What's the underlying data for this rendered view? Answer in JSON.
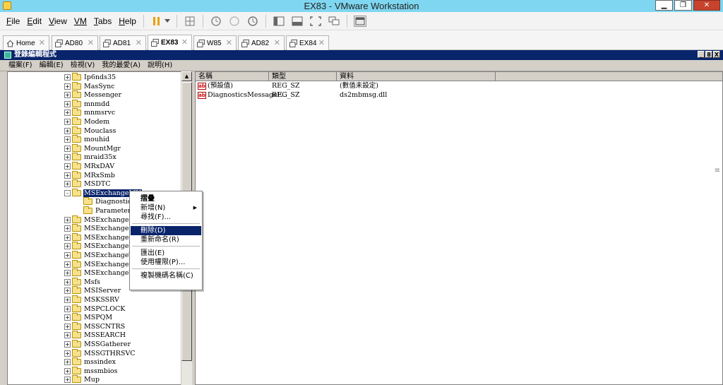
{
  "window": {
    "title": "EX83 - VMware Workstation",
    "controls": {
      "minimize": "▁",
      "restore": "❐",
      "close": "✕"
    }
  },
  "vmware_menu": {
    "items": [
      {
        "mnemonic": "F",
        "rest": "ile"
      },
      {
        "mnemonic": "E",
        "rest": "dit"
      },
      {
        "mnemonic": "V",
        "rest": "iew"
      },
      {
        "mnemonic": "",
        "rest": "VM"
      },
      {
        "mnemonic": "T",
        "rest": "abs"
      },
      {
        "mnemonic": "H",
        "rest": "elp"
      }
    ]
  },
  "tabs": [
    {
      "label": "Home",
      "icon": "home-icon",
      "active": false
    },
    {
      "label": "AD80",
      "icon": "vm-icon",
      "active": false
    },
    {
      "label": "AD81",
      "icon": "vm-icon",
      "active": false
    },
    {
      "label": "EX83",
      "icon": "vm-icon",
      "active": true
    },
    {
      "label": "W85",
      "icon": "vm-icon",
      "active": false
    },
    {
      "label": "AD82",
      "icon": "vm-icon",
      "active": false
    },
    {
      "label": "EX84",
      "icon": "vm-icon",
      "active": false
    }
  ],
  "regedit": {
    "title": "登錄編輯程式",
    "controls": [
      "_",
      "8",
      "X"
    ],
    "menu": [
      "檔案(F)",
      "編輯(E)",
      "檢視(V)",
      "我的最愛(A)",
      "說明(H)"
    ],
    "tree": [
      {
        "label": "Ip6nds35",
        "expand": "+"
      },
      {
        "label": "MasSync",
        "expand": "+"
      },
      {
        "label": "Messenger",
        "expand": "+"
      },
      {
        "label": "mnmdd",
        "expand": "+"
      },
      {
        "label": "mnmsrvc",
        "expand": "+"
      },
      {
        "label": "Modem",
        "expand": "+"
      },
      {
        "label": "Mouclass",
        "expand": "+"
      },
      {
        "label": "mouhid",
        "expand": "+"
      },
      {
        "label": "MountMgr",
        "expand": "+"
      },
      {
        "label": "mraid35x",
        "expand": "+"
      },
      {
        "label": "MRxDAV",
        "expand": "+"
      },
      {
        "label": "MRxSmb",
        "expand": "+"
      },
      {
        "label": "MSDTC",
        "expand": "+"
      },
      {
        "label": "MSExchangeMU",
        "expand": "-",
        "selected": true
      },
      {
        "label": "Diagnostics",
        "expand": "",
        "child": true
      },
      {
        "label": "Parameters",
        "expand": "",
        "child": true
      },
      {
        "label": "MSExchangeOM",
        "expand": "+"
      },
      {
        "label": "MSExchangeSA",
        "expand": "+"
      },
      {
        "label": "MSExchangeSend",
        "expand": "+"
      },
      {
        "label": "MSExchangeSRS",
        "expand": "+"
      },
      {
        "label": "MSExchangeTran",
        "expand": "+"
      },
      {
        "label": "MSExchangeUCE",
        "expand": "+"
      },
      {
        "label": "MSExchangeWEB",
        "expand": "+"
      },
      {
        "label": "Msfs",
        "expand": "+"
      },
      {
        "label": "MSIServer",
        "expand": "+"
      },
      {
        "label": "MSKSSRV",
        "expand": "+"
      },
      {
        "label": "MSPCLOCK",
        "expand": "+"
      },
      {
        "label": "MSPQM",
        "expand": "+"
      },
      {
        "label": "MSSCNTRS",
        "expand": "+"
      },
      {
        "label": "MSSEARCH",
        "expand": "+"
      },
      {
        "label": "MSSGatherer",
        "expand": "+"
      },
      {
        "label": "MSSGTHRSVC",
        "expand": "+"
      },
      {
        "label": "mssindex",
        "expand": "+"
      },
      {
        "label": "mssmbios",
        "expand": "+"
      },
      {
        "label": "Mup",
        "expand": "+"
      }
    ],
    "list": {
      "columns": [
        "名稱",
        "類型",
        "資料"
      ],
      "rows": [
        {
          "name": "(預設值)",
          "type": "REG_SZ",
          "data": "(數值未設定)"
        },
        {
          "name": "DiagnosticsMessageF...",
          "type": "REG_SZ",
          "data": "ds2mbmsg.dll"
        }
      ]
    },
    "context_menu": {
      "items": [
        {
          "label": "摺疊",
          "bold": true
        },
        {
          "label": "新增(N)",
          "submenu": true
        },
        {
          "label": "尋找(F)..."
        },
        {
          "sep": true
        },
        {
          "label": "刪除(D)",
          "highlighted": true
        },
        {
          "label": "重新命名(R)"
        },
        {
          "sep": true
        },
        {
          "label": "匯出(E)"
        },
        {
          "label": "使用權限(P)..."
        },
        {
          "sep": true
        },
        {
          "label": "複製機碼名稱(C)"
        }
      ]
    }
  },
  "colors": {
    "vmware_titlebar": "#7fd6f0",
    "regedit_titlebar": "#08246b",
    "selection": "#0a246a"
  }
}
